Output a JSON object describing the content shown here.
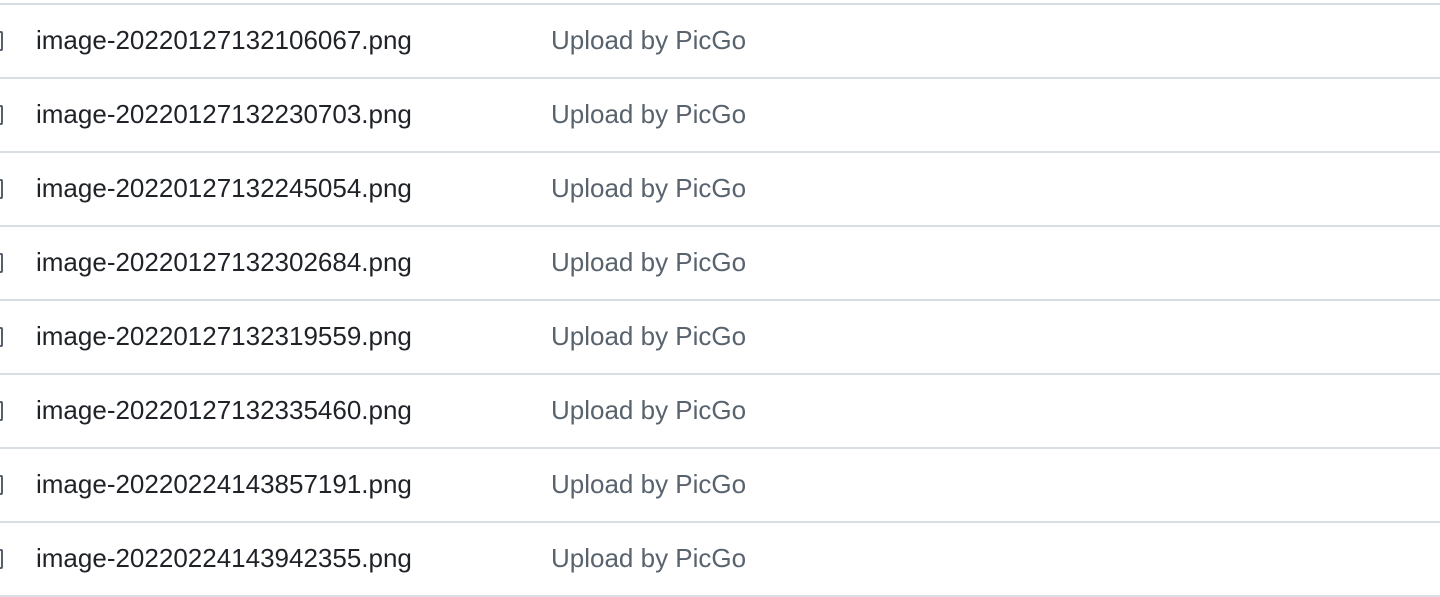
{
  "files": [
    {
      "name": "image-20220127132106067.png",
      "commit_message": "Upload by PicGo",
      "icon": "file-icon"
    },
    {
      "name": "image-20220127132230703.png",
      "commit_message": "Upload by PicGo",
      "icon": "file-icon"
    },
    {
      "name": "image-20220127132245054.png",
      "commit_message": "Upload by PicGo",
      "icon": "file-icon"
    },
    {
      "name": "image-20220127132302684.png",
      "commit_message": "Upload by PicGo",
      "icon": "file-icon"
    },
    {
      "name": "image-20220127132319559.png",
      "commit_message": "Upload by PicGo",
      "icon": "file-icon"
    },
    {
      "name": "image-20220127132335460.png",
      "commit_message": "Upload by PicGo",
      "icon": "file-icon"
    },
    {
      "name": "image-20220224143857191.png",
      "commit_message": "Upload by PicGo",
      "icon": "file-icon"
    },
    {
      "name": "image-20220224143942355.png",
      "commit_message": "Upload by PicGo",
      "icon": "file-icon"
    }
  ]
}
